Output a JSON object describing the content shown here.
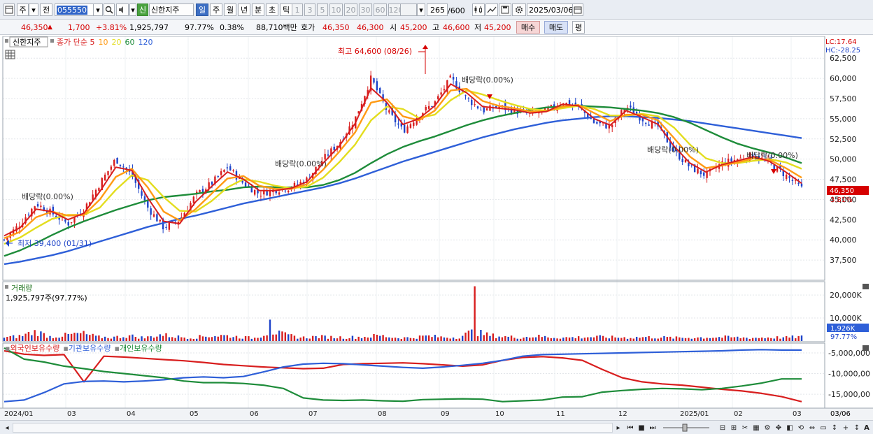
{
  "toolbar": {
    "market": "주",
    "period_prev": "전",
    "code": "055550",
    "badge": "신",
    "name": "신한지주",
    "periods": [
      {
        "label": "일",
        "selected": true
      },
      {
        "label": "주",
        "selected": false
      },
      {
        "label": "월",
        "selected": false
      },
      {
        "label": "년",
        "selected": false
      },
      {
        "label": "분",
        "selected": false
      },
      {
        "label": "초",
        "selected": false
      },
      {
        "label": "틱",
        "selected": false
      }
    ],
    "intervals": [
      "1",
      "3",
      "5",
      "10",
      "20",
      "30",
      "60",
      "120"
    ],
    "count": "265",
    "count_total": "/600",
    "date": "2025/03/06"
  },
  "quote": {
    "price": "46,350",
    "change": "1,700",
    "change_pct": "+3.81%",
    "volume": "1,925,797",
    "volume_ratio": "97.77%",
    "turnover": "0.38%",
    "amount": "88,710백만",
    "bid_label": "호가",
    "ask": "46,350",
    "bid": "46,300",
    "open_label": "시",
    "open": "45,200",
    "high_label": "고",
    "high": "46,600",
    "low_label": "저",
    "low": "45,200",
    "buy_label": "매수",
    "sell_label": "매도",
    "rate_label": "평"
  },
  "price_panel": {
    "stock": "신한지주",
    "legend": [
      {
        "text": "종가 단순 5",
        "color": "#d81e1e"
      },
      {
        "text": "10",
        "color": "#ff9a14"
      },
      {
        "text": "20",
        "color": "#e3dd1e"
      },
      {
        "text": "60",
        "color": "#1e8c3a"
      },
      {
        "text": "120",
        "color": "#2e5fd8"
      }
    ],
    "lc": "LC:17.64",
    "hc": "HC:-28.25",
    "last_price": "46,350",
    "last_pct": "3.81%",
    "high_note": "최고 64,600 (08/26)",
    "low_note": "최저 39,400 (01/31)",
    "dividend_notes": [
      "배당락(0.00%)",
      "배당락(0.00%)",
      "배당락(0.00%)",
      "배당락(0.00%)",
      "배당락(0.00%)"
    ]
  },
  "volume_panel": {
    "title": "거래량",
    "value": "1,925,797주(97.77%)",
    "last": "1,926K",
    "last_pct": "97.77%"
  },
  "holding_panel": {
    "legend": [
      {
        "text": "외국인보유수량",
        "color": "#d81e1e"
      },
      {
        "text": "기관보유수량",
        "color": "#2e5fd8"
      },
      {
        "text": "개인보유수량",
        "color": "#1e8c3a"
      }
    ]
  },
  "x_axis": {
    "labels": [
      "2024/01",
      "03",
      "04",
      "05",
      "06",
      "07",
      "08",
      "09",
      "10",
      "11",
      "12",
      "2025/01",
      "02",
      "03"
    ],
    "right_label": "03/06"
  },
  "colors": {
    "up": "#d81e1e",
    "down": "#1d43c9",
    "ma5": "#d81e1e",
    "ma10": "#ff9a14",
    "ma20": "#e3dd1e",
    "ma60": "#1e8c3a",
    "ma120": "#2e5fd8"
  },
  "chart_data": [
    {
      "type": "line",
      "title": "신한지주",
      "note": "estimated daily closes and moving averages, read from the price panel",
      "y_axis_ticks": [
        "62,500",
        "60,000",
        "57,500",
        "55,000",
        "52,500",
        "50,000",
        "47,500",
        "45,000",
        "42,500",
        "40,000",
        "37,500"
      ],
      "ylim": [
        35000,
        65200
      ],
      "x_labels": [
        "2024/01",
        "03",
        "04",
        "05",
        "06",
        "07",
        "08",
        "09",
        "10",
        "11",
        "12",
        "2025/01",
        "02",
        "03"
      ],
      "series": [
        {
          "name": "종가",
          "values": [
            40000,
            42000,
            44500,
            43300,
            42000,
            43800,
            47000,
            50000,
            48000,
            44000,
            41500,
            42500,
            45500,
            47000,
            49000,
            47000,
            45700,
            46200,
            46500,
            47500,
            50000,
            52000,
            55000,
            60000,
            56000,
            53500,
            55500,
            57000,
            60000,
            57500,
            56000,
            56500,
            56000,
            55500,
            56000,
            57000,
            56500,
            54500,
            54000,
            56500,
            55000,
            54000,
            51000,
            49000,
            48000,
            49500,
            50000,
            50500,
            49500,
            48000,
            46350
          ]
        },
        {
          "name": "5",
          "values": [
            40500,
            41500,
            43800,
            43500,
            42500,
            43300,
            46000,
            49000,
            48600,
            45200,
            42300,
            42000,
            44700,
            46600,
            48400,
            47500,
            46100,
            46100,
            46400,
            47200,
            49500,
            51600,
            54400,
            58800,
            57000,
            54300,
            55000,
            56600,
            59300,
            58200,
            56500,
            56300,
            56100,
            55700,
            55900,
            56800,
            56600,
            55000,
            54200,
            56000,
            55200,
            54300,
            51600,
            49500,
            48400,
            49300,
            49800,
            50300,
            49700,
            48400,
            47000
          ]
        },
        {
          "name": "10",
          "values": [
            40200,
            41000,
            42800,
            43500,
            43000,
            43100,
            45000,
            47800,
            48800,
            46500,
            43500,
            42400,
            43800,
            45700,
            47600,
            47900,
            46700,
            46300,
            46300,
            46900,
            48700,
            50900,
            53300,
            57000,
            57400,
            55300,
            54800,
            56000,
            58500,
            58700,
            57200,
            56600,
            56300,
            55900,
            55900,
            56500,
            56700,
            55700,
            54700,
            55500,
            55500,
            54800,
            52600,
            50300,
            48900,
            49200,
            49600,
            50100,
            49900,
            48900,
            47700
          ]
        },
        {
          "name": "20",
          "values": [
            39500,
            40300,
            41500,
            42600,
            43100,
            43100,
            44000,
            46200,
            48000,
            47400,
            45300,
            43600,
            43500,
            44800,
            46500,
            47500,
            47200,
            46700,
            46400,
            46600,
            47700,
            49600,
            51800,
            54800,
            56500,
            56200,
            55100,
            55500,
            57300,
            58500,
            58000,
            57300,
            56700,
            56200,
            56000,
            56300,
            56600,
            56200,
            55400,
            55400,
            55600,
            55300,
            53900,
            51800,
            50100,
            49500,
            49500,
            49800,
            50000,
            49600,
            48800
          ]
        },
        {
          "name": "60",
          "values": [
            38000,
            38700,
            39600,
            40600,
            41500,
            42300,
            43000,
            43700,
            44300,
            44900,
            45300,
            45500,
            45700,
            46000,
            46200,
            46500,
            46600,
            46500,
            46500,
            46500,
            46800,
            47400,
            48300,
            49500,
            50600,
            51500,
            52200,
            52800,
            53500,
            54200,
            54800,
            55300,
            55700,
            56100,
            56400,
            56500,
            56600,
            56500,
            56400,
            56200,
            56000,
            55700,
            55200,
            54500,
            53600,
            52700,
            51900,
            51300,
            50800,
            50200,
            49500
          ]
        },
        {
          "name": "120",
          "values": [
            37000,
            37300,
            37700,
            38100,
            38600,
            39200,
            39800,
            40400,
            41000,
            41600,
            42100,
            42600,
            43000,
            43500,
            44000,
            44500,
            44900,
            45300,
            45700,
            46100,
            46500,
            47000,
            47600,
            48300,
            49000,
            49700,
            50300,
            50900,
            51500,
            52100,
            52700,
            53200,
            53700,
            54100,
            54500,
            54800,
            55000,
            55200,
            55300,
            55300,
            55200,
            55100,
            54900,
            54700,
            54400,
            54100,
            53800,
            53500,
            53200,
            52900,
            52600
          ]
        }
      ]
    },
    {
      "type": "bar",
      "title": "거래량",
      "y_axis_ticks": [
        "20,000K",
        "10,000K"
      ],
      "ylim": [
        0,
        25500
      ],
      "note": "volume in thousands of shares, estimated; index = trading day",
      "values": [
        1500,
        2100,
        4100,
        1800,
        2600,
        3300,
        1700,
        1600,
        2300,
        1400,
        2800,
        1900,
        1500,
        2200,
        2400,
        1800,
        1300,
        9300,
        2600,
        1500,
        1900,
        1700,
        1600,
        1800,
        2400,
        1500,
        1400,
        2200,
        1700,
        1600,
        23800,
        2500,
        1900,
        1600,
        2100,
        1600,
        1500,
        1700,
        1800,
        1600,
        1500,
        1700,
        1600,
        1400,
        1500,
        1600,
        1700,
        1500,
        1400,
        1600,
        1500,
        1926
      ]
    },
    {
      "type": "line",
      "title": "외국인보유수량 / 기관보유수량 / 개인보유수량",
      "y_axis_ticks": [
        "-5,000,000",
        "-10,000,00",
        "-15,000,00"
      ],
      "ylim": [
        -18200000,
        -2800000
      ],
      "series": [
        {
          "name": "외국인보유수량",
          "values": [
            -4500000,
            -5300000,
            -5600000,
            -5400000,
            -12000000,
            -5800000,
            -6000000,
            -6300000,
            -6600000,
            -6900000,
            -7300000,
            -7800000,
            -8100000,
            -8400000,
            -8600000,
            -8800000,
            -8700000,
            -7800000,
            -7600000,
            -7500000,
            -7400000,
            -7600000,
            -7900000,
            -8200000,
            -7900000,
            -6800000,
            -6100000,
            -5900000,
            -6200000,
            -6800000,
            -9000000,
            -11000000,
            -12000000,
            -12500000,
            -12800000,
            -13300000,
            -13800000,
            -14200000,
            -14800000,
            -15600000,
            -16800000
          ]
        },
        {
          "name": "기관보유수량",
          "values": [
            -16800000,
            -16400000,
            -14600000,
            -12500000,
            -11900000,
            -11800000,
            -12000000,
            -11800000,
            -11500000,
            -11000000,
            -10800000,
            -11000000,
            -10700000,
            -9600000,
            -8400000,
            -7700000,
            -7500000,
            -7600000,
            -7900000,
            -8200000,
            -8500000,
            -8700000,
            -8400000,
            -8000000,
            -7500000,
            -6800000,
            -5800000,
            -5400000,
            -5300000,
            -5200000,
            -5100000,
            -5000000,
            -4900000,
            -4800000,
            -4700000,
            -4600000,
            -4500000,
            -4300000,
            -4200000,
            -4300000,
            -4300000
          ]
        },
        {
          "name": "개인보유수량",
          "values": [
            -3800000,
            -6500000,
            -7200000,
            -8200000,
            -8800000,
            -9500000,
            -10000000,
            -10500000,
            -11000000,
            -11800000,
            -12200000,
            -12200000,
            -12400000,
            -12800000,
            -13600000,
            -15900000,
            -16400000,
            -16500000,
            -16400000,
            -16600000,
            -16700000,
            -16300000,
            -16200000,
            -16100000,
            -16200000,
            -16800000,
            -16600000,
            -16400000,
            -15700000,
            -15600000,
            -14500000,
            -14100000,
            -13800000,
            -13600000,
            -13700000,
            -13900000,
            -13600000,
            -13000000,
            -12300000,
            -11300000,
            -11300000
          ]
        }
      ]
    }
  ]
}
